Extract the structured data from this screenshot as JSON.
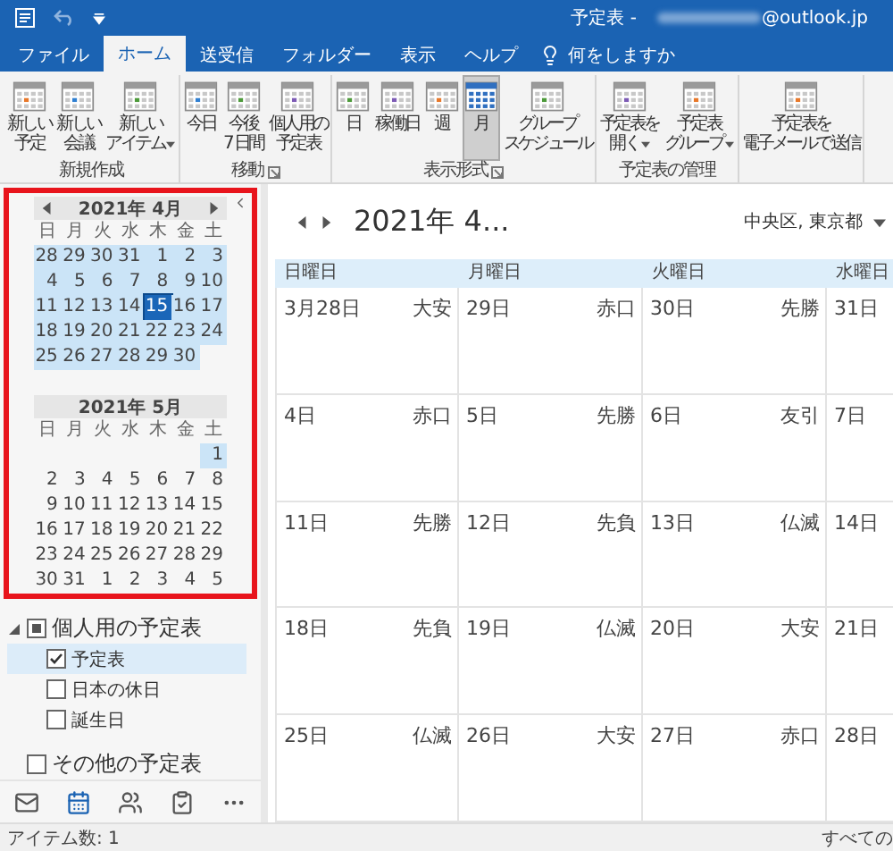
{
  "title_bar": {
    "title": "予定表 -",
    "account": "@outlook.jp"
  },
  "tabs": [
    {
      "label": "ファイル",
      "selected": false
    },
    {
      "label": "ホーム",
      "selected": true
    },
    {
      "label": "送受信",
      "selected": false
    },
    {
      "label": "フォルダー",
      "selected": false
    },
    {
      "label": "表示",
      "selected": false
    },
    {
      "label": "ヘルプ",
      "selected": false
    }
  ],
  "tell_me": "何をしますか",
  "ribbon": {
    "groups": [
      {
        "label": "新規作成",
        "buttons": [
          {
            "lines": [
              "新しい",
              "予定"
            ]
          },
          {
            "lines": [
              "新しい",
              "会議"
            ]
          },
          {
            "lines": [
              "新しい",
              "アイテム"
            ],
            "dropdown": true
          }
        ]
      },
      {
        "label": "移動",
        "launcher": true,
        "buttons": [
          {
            "lines": [
              "今日"
            ]
          },
          {
            "lines": [
              "今後",
              "7 日間"
            ]
          },
          {
            "lines": [
              "個人用の",
              "予定表"
            ]
          }
        ]
      },
      {
        "label": "表示形式",
        "launcher": true,
        "buttons": [
          {
            "lines": [
              "日"
            ],
            "selected": false
          },
          {
            "lines": [
              "稼働日"
            ],
            "selected": false
          },
          {
            "lines": [
              "週"
            ],
            "selected": false
          },
          {
            "lines": [
              "月"
            ],
            "selected": true
          },
          {
            "lines": [
              "グループ",
              "スケジュール"
            ],
            "selected": false
          }
        ]
      },
      {
        "label": "予定表の管理",
        "buttons": [
          {
            "lines": [
              "予定表を",
              "開く"
            ],
            "dropdown": true
          },
          {
            "lines": [
              "予定表",
              "グループ"
            ],
            "dropdown": true
          }
        ]
      },
      {
        "buttons": [
          {
            "lines": [
              "予定表を",
              "電子メールで送信"
            ]
          }
        ]
      }
    ]
  },
  "mini_calendars": [
    {
      "title": "2021年 4月",
      "arrows": true,
      "weekdays": [
        "日",
        "月",
        "火",
        "水",
        "木",
        "金",
        "土"
      ],
      "weeks": [
        [
          {
            "day": "28",
            "in_range": true,
            "selected": false
          },
          {
            "day": "29",
            "in_range": true,
            "selected": false
          },
          {
            "day": "30",
            "in_range": true,
            "selected": false
          },
          {
            "day": "31",
            "in_range": true,
            "selected": false
          },
          {
            "day": "1",
            "in_range": true,
            "selected": false
          },
          {
            "day": "2",
            "in_range": true,
            "selected": false
          },
          {
            "day": "3",
            "in_range": true,
            "selected": false
          }
        ],
        [
          {
            "day": "4",
            "in_range": true,
            "selected": false
          },
          {
            "day": "5",
            "in_range": true,
            "selected": false
          },
          {
            "day": "6",
            "in_range": true,
            "selected": false
          },
          {
            "day": "7",
            "in_range": true,
            "selected": false
          },
          {
            "day": "8",
            "in_range": true,
            "selected": false
          },
          {
            "day": "9",
            "in_range": true,
            "selected": false
          },
          {
            "day": "10",
            "in_range": true,
            "selected": false
          }
        ],
        [
          {
            "day": "11",
            "in_range": true,
            "selected": false
          },
          {
            "day": "12",
            "in_range": true,
            "selected": false
          },
          {
            "day": "13",
            "in_range": true,
            "selected": false
          },
          {
            "day": "14",
            "in_range": true,
            "selected": false
          },
          {
            "day": "15",
            "in_range": true,
            "selected": true
          },
          {
            "day": "16",
            "in_range": true,
            "selected": false
          },
          {
            "day": "17",
            "in_range": true,
            "selected": false
          }
        ],
        [
          {
            "day": "18",
            "in_range": true,
            "selected": false
          },
          {
            "day": "19",
            "in_range": true,
            "selected": false
          },
          {
            "day": "20",
            "in_range": true,
            "selected": false
          },
          {
            "day": "21",
            "in_range": true,
            "selected": false
          },
          {
            "day": "22",
            "in_range": true,
            "selected": false
          },
          {
            "day": "23",
            "in_range": true,
            "selected": false
          },
          {
            "day": "24",
            "in_range": true,
            "selected": false
          }
        ],
        [
          {
            "day": "25",
            "in_range": true,
            "selected": false
          },
          {
            "day": "26",
            "in_range": true,
            "selected": false
          },
          {
            "day": "27",
            "in_range": true,
            "selected": false
          },
          {
            "day": "28",
            "in_range": true,
            "selected": false
          },
          {
            "day": "29",
            "in_range": true,
            "selected": false
          },
          {
            "day": "30",
            "in_range": true,
            "selected": false
          }
        ]
      ]
    },
    {
      "title": "2021年 5月",
      "arrows": false,
      "weekdays": [
        "日",
        "月",
        "火",
        "水",
        "木",
        "金",
        "土"
      ],
      "weeks": [
        [
          {
            "day": "1",
            "in_range": true,
            "selected": false
          }
        ],
        [
          {
            "day": "2",
            "in_range": false,
            "selected": false
          },
          {
            "day": "3",
            "in_range": false,
            "selected": false
          },
          {
            "day": "4",
            "in_range": false,
            "selected": false
          },
          {
            "day": "5",
            "in_range": false,
            "selected": false
          },
          {
            "day": "6",
            "in_range": false,
            "selected": false
          },
          {
            "day": "7",
            "in_range": false,
            "selected": false
          },
          {
            "day": "8",
            "in_range": false,
            "selected": false
          }
        ],
        [
          {
            "day": "9",
            "in_range": false,
            "selected": false
          },
          {
            "day": "10",
            "in_range": false,
            "selected": false
          },
          {
            "day": "11",
            "in_range": false,
            "selected": false
          },
          {
            "day": "12",
            "in_range": false,
            "selected": false
          },
          {
            "day": "13",
            "in_range": false,
            "selected": false
          },
          {
            "day": "14",
            "in_range": false,
            "selected": false
          },
          {
            "day": "15",
            "in_range": false,
            "selected": false
          }
        ],
        [
          {
            "day": "16",
            "in_range": false,
            "selected": false
          },
          {
            "day": "17",
            "in_range": false,
            "selected": false
          },
          {
            "day": "18",
            "in_range": false,
            "selected": false
          },
          {
            "day": "19",
            "in_range": false,
            "selected": false
          },
          {
            "day": "20",
            "in_range": false,
            "selected": false
          },
          {
            "day": "21",
            "in_range": false,
            "selected": false
          },
          {
            "day": "22",
            "in_range": false,
            "selected": false
          }
        ],
        [
          {
            "day": "23",
            "in_range": false,
            "selected": false
          },
          {
            "day": "24",
            "in_range": false,
            "selected": false
          },
          {
            "day": "25",
            "in_range": false,
            "selected": false
          },
          {
            "day": "26",
            "in_range": false,
            "selected": false
          },
          {
            "day": "27",
            "in_range": false,
            "selected": false
          },
          {
            "day": "28",
            "in_range": false,
            "selected": false
          },
          {
            "day": "29",
            "in_range": false,
            "selected": false
          }
        ],
        [
          {
            "day": "30",
            "in_range": false,
            "selected": false
          },
          {
            "day": "31",
            "in_range": false,
            "selected": false
          },
          {
            "day": "1",
            "in_range": false,
            "selected": false
          },
          {
            "day": "2",
            "in_range": false,
            "selected": false
          },
          {
            "day": "3",
            "in_range": false,
            "selected": false
          },
          {
            "day": "4",
            "in_range": false,
            "selected": false
          },
          {
            "day": "5",
            "in_range": false,
            "selected": false
          }
        ]
      ]
    }
  ],
  "calendar_tree": [
    {
      "label": "個人用の予定表",
      "expanded": true,
      "checked": false,
      "partial": true,
      "children": [
        {
          "label": "予定表",
          "checked": true,
          "selected": true
        },
        {
          "label": "日本の休日",
          "checked": false,
          "selected": false
        },
        {
          "label": "誕生日",
          "checked": false,
          "selected": false
        }
      ]
    },
    {
      "label": "その他の予定表",
      "checked": false,
      "partial": false
    }
  ],
  "nav_bar": [
    {
      "selected": false
    },
    {
      "selected": true
    },
    {
      "selected": false
    },
    {
      "selected": false
    },
    {
      "selected": false
    }
  ],
  "main": {
    "date_title": "2021年 4...",
    "location": "中央区, 東京都",
    "columns": [
      "日曜日",
      "月曜日",
      "火曜日",
      "水曜日"
    ],
    "weeks": [
      [
        {
          "date": "3月28日",
          "label": "大安"
        },
        {
          "date": "29日",
          "label": "赤口"
        },
        {
          "date": "30日",
          "label": "先勝"
        },
        {
          "date": "31日"
        }
      ],
      [
        {
          "date": "4日",
          "label": "赤口"
        },
        {
          "date": "5日",
          "label": "先勝"
        },
        {
          "date": "6日",
          "label": "友引"
        },
        {
          "date": "7日"
        }
      ],
      [
        {
          "date": "11日",
          "label": "先勝"
        },
        {
          "date": "12日",
          "label": "先負"
        },
        {
          "date": "13日",
          "label": "仏滅"
        },
        {
          "date": "14日"
        }
      ],
      [
        {
          "date": "18日",
          "label": "先負"
        },
        {
          "date": "19日",
          "label": "仏滅"
        },
        {
          "date": "20日",
          "label": "大安"
        },
        {
          "date": "21日"
        }
      ],
      [
        {
          "date": "25日",
          "label": "仏滅"
        },
        {
          "date": "26日",
          "label": "大安"
        },
        {
          "date": "27日",
          "label": "赤口"
        },
        {
          "date": "28日"
        }
      ]
    ]
  },
  "status_bar": {
    "count": "アイテム数: 1",
    "right": "すべての"
  }
}
